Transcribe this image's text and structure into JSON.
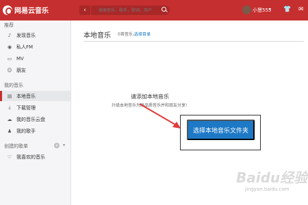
{
  "app": {
    "name": "网易云音乐"
  },
  "header": {
    "search_placeholder": "搜索音乐，歌手，歌词，用户",
    "back": "‹",
    "forward": "›",
    "username": "小慧555",
    "caret": "▾",
    "skin_icon": "👕",
    "mail_icon": "✉"
  },
  "sidebar": {
    "sections": [
      {
        "title": "推荐",
        "items": [
          {
            "label": "发现音乐",
            "icon": "music-note-icon"
          },
          {
            "label": "私人FM",
            "icon": "radio-icon"
          },
          {
            "label": "MV",
            "icon": "video-icon"
          },
          {
            "label": "朋友",
            "icon": "friends-icon"
          }
        ]
      },
      {
        "title": "我的音乐",
        "items": [
          {
            "label": "本地音乐",
            "icon": "local-music-icon",
            "active": true
          },
          {
            "label": "下载管理",
            "icon": "download-icon"
          },
          {
            "label": "我的音乐云盘",
            "icon": "cloud-icon"
          },
          {
            "label": "我的歌手",
            "icon": "singer-icon"
          }
        ]
      },
      {
        "title": "创建的歌单",
        "items": [
          {
            "label": "我喜欢的音乐",
            "icon": "heart-icon"
          }
        ]
      }
    ],
    "add_icon": "+",
    "collapse_icon": "▾"
  },
  "main": {
    "title": "本地音乐",
    "count": "0首音乐，",
    "select_dir": "选择目录",
    "prompt": "请添加本地音乐",
    "hint": "升级本地音乐为高品质音乐并和朋友分享!",
    "button": "选择本地音乐文件夹"
  },
  "watermark": {
    "text": "Baidu经验",
    "sub": "jingyan.baidu.com"
  },
  "colors": {
    "brand": "#c62f2f",
    "button": "#1d79c6",
    "arrow": "#e03a3a"
  }
}
